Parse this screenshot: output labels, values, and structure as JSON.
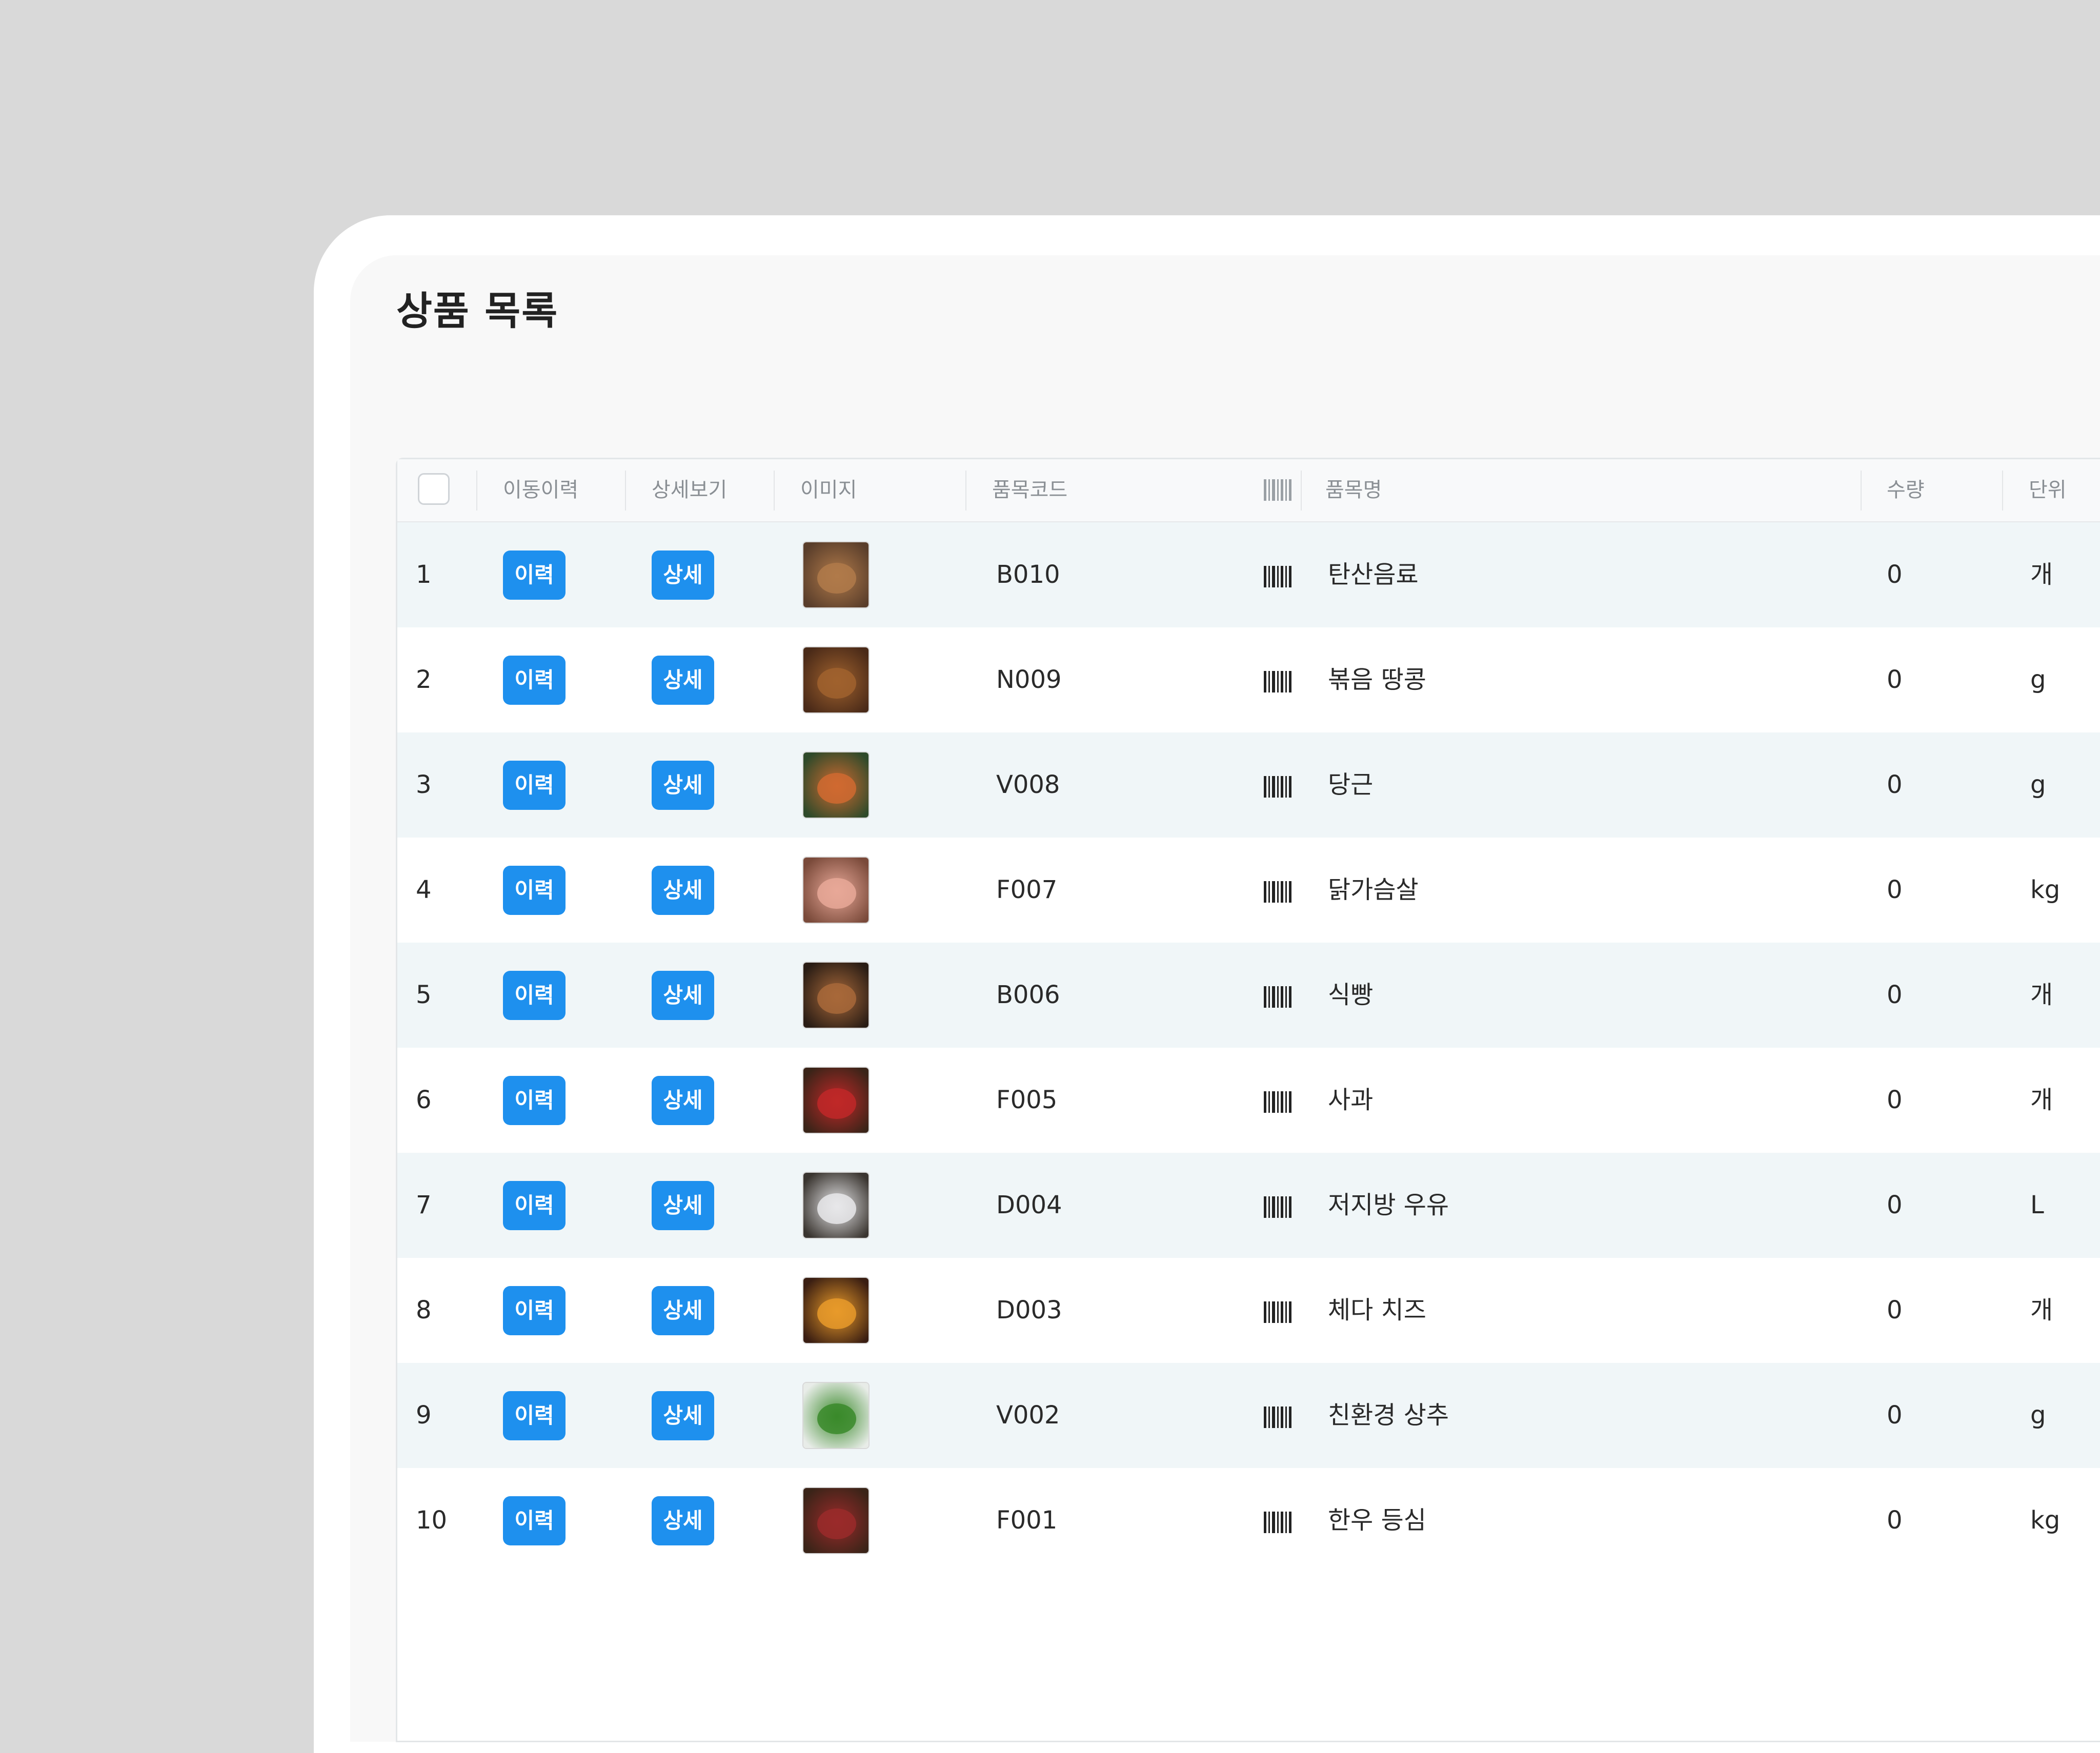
{
  "page": {
    "title": "상품 목록"
  },
  "table": {
    "headers": {
      "history": "이동이력",
      "detail": "상세보기",
      "image": "이미지",
      "code": "품목코드",
      "name": "품목명",
      "qty": "수량",
      "unit": "단위"
    },
    "history_button_label": "이력",
    "detail_button_label": "상세",
    "rows": [
      {
        "no": "1",
        "code": "B010",
        "name": "탄산음료",
        "qty": "0",
        "unit": "개",
        "image": "carbonated-drink-photo"
      },
      {
        "no": "2",
        "code": "N009",
        "name": "볶음 땅콩",
        "qty": "0",
        "unit": "g",
        "image": "roasted-peanuts-photo"
      },
      {
        "no": "3",
        "code": "V008",
        "name": "당근",
        "qty": "0",
        "unit": "g",
        "image": "carrot-photo"
      },
      {
        "no": "4",
        "code": "F007",
        "name": "닭가슴살",
        "qty": "0",
        "unit": "kg",
        "image": "chicken-breast-photo"
      },
      {
        "no": "5",
        "code": "B006",
        "name": "식빵",
        "qty": "0",
        "unit": "개",
        "image": "bread-photo"
      },
      {
        "no": "6",
        "code": "F005",
        "name": "사과",
        "qty": "0",
        "unit": "개",
        "image": "apple-photo"
      },
      {
        "no": "7",
        "code": "D004",
        "name": "저지방 우유",
        "qty": "0",
        "unit": "L",
        "image": "low-fat-milk-photo"
      },
      {
        "no": "8",
        "code": "D003",
        "name": "체다 치즈",
        "qty": "0",
        "unit": "개",
        "image": "cheddar-cheese-photo"
      },
      {
        "no": "9",
        "code": "V002",
        "name": "친환경 상추",
        "qty": "0",
        "unit": "g",
        "image": "lettuce-photo"
      },
      {
        "no": "10",
        "code": "F001",
        "name": "한우 등심",
        "qty": "0",
        "unit": "kg",
        "image": "korean-beef-sirloin-photo"
      }
    ]
  },
  "colors": {
    "accent": "#1e90ee",
    "row_alt": "#f0f6f8",
    "background": "#d9d9d9"
  }
}
